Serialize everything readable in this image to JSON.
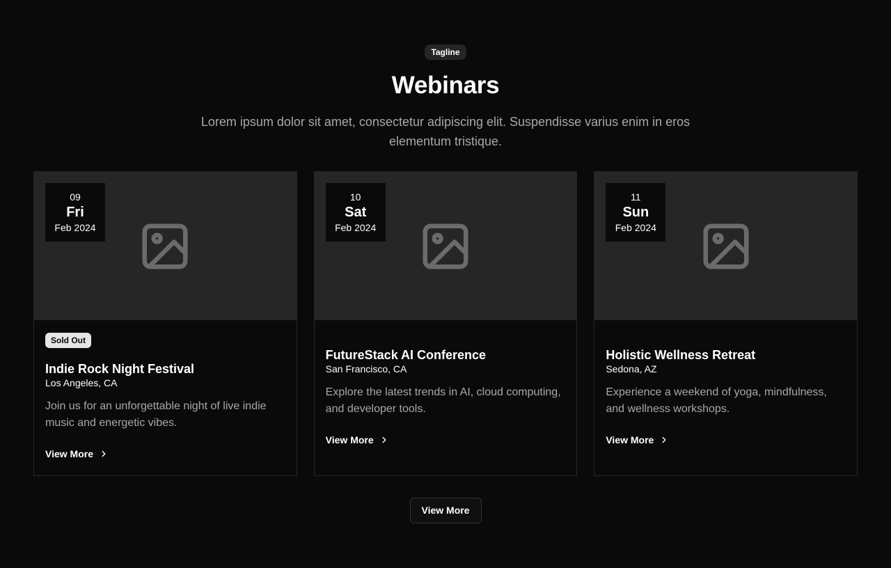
{
  "header": {
    "tagline": "Tagline",
    "title": "Webinars",
    "subtitle": "Lorem ipsum dolor sit amet, consectetur adipiscing elit. Suspendisse varius enim in eros elementum tristique."
  },
  "cards": [
    {
      "date_day": "09",
      "date_weekday": "Fri",
      "date_month_year": "Feb 2024",
      "image_icon": "image-placeholder-icon",
      "badge": "Sold Out",
      "title": "Indie Rock Night Festival",
      "location": "Los Angeles, CA",
      "description": "Join us for an unforgettable night of live indie music and energetic vibes.",
      "link_label": "View More",
      "link_icon": "chevron-right-icon"
    },
    {
      "date_day": "10",
      "date_weekday": "Sat",
      "date_month_year": "Feb 2024",
      "image_icon": "image-placeholder-icon",
      "title": "FutureStack AI Conference",
      "location": "San Francisco, CA",
      "description": "Explore the latest trends in AI, cloud computing, and developer tools.",
      "link_label": "View More",
      "link_icon": "chevron-right-icon"
    },
    {
      "date_day": "11",
      "date_weekday": "Sun",
      "date_month_year": "Feb 2024",
      "image_icon": "image-placeholder-icon",
      "title": "Holistic Wellness Retreat",
      "location": "Sedona, AZ",
      "description": "Experience a weekend of yoga, mindfulness, and wellness workshops.",
      "link_label": "View More",
      "link_icon": "chevron-right-icon"
    }
  ],
  "footer": {
    "view_more_label": "View More"
  },
  "colors": {
    "background": "#0a0a0a",
    "card_media": "#262626",
    "muted_text": "#a8a8a8",
    "badge_bg": "#e6e6e6"
  }
}
